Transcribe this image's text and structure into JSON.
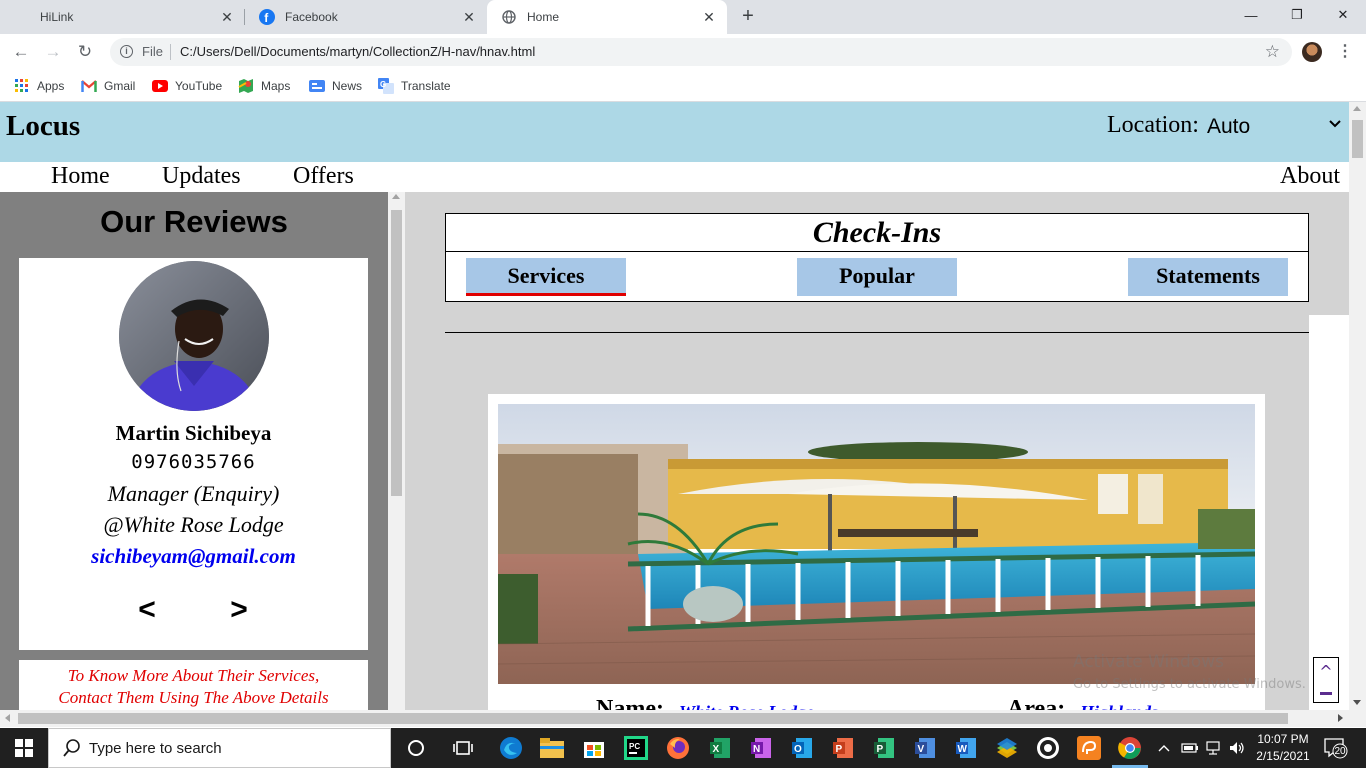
{
  "browser": {
    "tabs": [
      {
        "title": "HiLink",
        "icon": "hilink-icon"
      },
      {
        "title": "Facebook",
        "icon": "facebook-icon"
      },
      {
        "title": "Home",
        "icon": "globe-icon",
        "active": true
      }
    ],
    "new_tab_symbol": "+",
    "window_controls": {
      "minimize": "—",
      "restore": "❐",
      "close": "✕"
    },
    "address": {
      "scheme_label": "File",
      "url": "C:/Users/Dell/Documents/martyn/CollectionZ/H-nav/hnav.html"
    },
    "bookmarks": [
      {
        "label": "Apps",
        "icon": "apps-grid-icon"
      },
      {
        "label": "Gmail",
        "icon": "gmail-icon"
      },
      {
        "label": "YouTube",
        "icon": "youtube-icon"
      },
      {
        "label": "Maps",
        "icon": "maps-icon"
      },
      {
        "label": "News",
        "icon": "news-icon"
      },
      {
        "label": "Translate",
        "icon": "translate-icon"
      }
    ]
  },
  "page": {
    "header": {
      "logo": "Locus",
      "location_label": "Location:",
      "location_value": "Auto"
    },
    "nav": {
      "home": "Home",
      "updates": "Updates",
      "offers": "Offers",
      "about": "About"
    },
    "sidebar": {
      "title": "Our Reviews",
      "review": {
        "name": "Martin Sichibeya",
        "phone": "0976035766",
        "role": "Manager (Enquiry)",
        "place": "@White Rose Lodge",
        "email": "sichibeyam@gmail.com",
        "prev": "<",
        "next": ">"
      },
      "contact_line1": "To Know More About Their Services,",
      "contact_line2": "Contact Them Using The Above Details"
    },
    "checkins": {
      "title": "Check-Ins",
      "tabs": [
        "Services",
        "Popular",
        "Statements"
      ],
      "active_tab": "Services"
    },
    "listing": {
      "name_label": "Name:",
      "name_value": "White Rose Lodge",
      "area_label": "Area:",
      "area_value": "Highlands"
    },
    "scroll_top_symbol": "^",
    "watermark": {
      "line1": "Activate Windows",
      "line2": "Go to Settings to activate Windows."
    }
  },
  "taskbar": {
    "search_placeholder": "Type here to search",
    "apps": [
      "task-view-icon",
      "cortana-icon",
      "edge-icon",
      "file-explorer-icon",
      "store-icon",
      "pycharm-icon",
      "firefox-icon",
      "excel-icon",
      "onenote-icon",
      "outlook-icon",
      "powerpoint-icon",
      "project-icon",
      "visio-icon",
      "word-icon",
      "bluestacks-icon",
      "obs-icon",
      "pdf-editor-icon",
      "chrome-icon"
    ],
    "time": "10:07 PM",
    "date": "2/15/2021",
    "notification_count": "20"
  },
  "colors": {
    "header_bg": "#add8e6",
    "sidebar_bg": "#808080",
    "main_bg": "#d3d3d3",
    "tab_bg": "#a7c7e7",
    "active_tab_underline": "#e00000",
    "link_blue": "#0000ee",
    "contact_red": "#e00000"
  }
}
